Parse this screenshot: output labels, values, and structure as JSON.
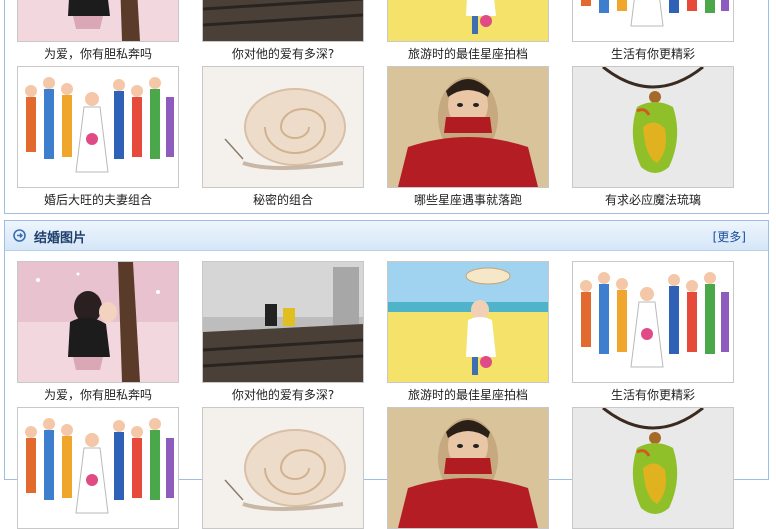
{
  "top_section": {
    "row1": [
      {
        "caption": "为爱，你有胆私奔吗",
        "art": "kiss"
      },
      {
        "caption": "你对他的爱有多深?",
        "art": "rail"
      },
      {
        "caption": "旅游时的最佳星座拍档",
        "art": "beach"
      },
      {
        "caption": "生活有你更精彩",
        "art": "crowd"
      }
    ],
    "row2": [
      {
        "caption": "婚后大旺的夫妻组合",
        "art": "crowd"
      },
      {
        "caption": "秘密的组合",
        "art": "snail"
      },
      {
        "caption": "哪些星座遇事就落跑",
        "art": "man"
      },
      {
        "caption": "有求必应魔法琉璃",
        "art": "glass"
      }
    ]
  },
  "wedding_section": {
    "title": "结婚图片",
    "more_label": "[更多]",
    "icon": "circle-arrow-right-icon",
    "row1": [
      {
        "caption": "为爱，你有胆私奔吗",
        "art": "kiss"
      },
      {
        "caption": "你对他的爱有多深?",
        "art": "rail"
      },
      {
        "caption": "旅游时的最佳星座拍档",
        "art": "beach"
      },
      {
        "caption": "生活有你更精彩",
        "art": "crowd"
      }
    ],
    "row2": [
      {
        "caption": "",
        "art": "crowd"
      },
      {
        "caption": "",
        "art": "snail"
      },
      {
        "caption": "",
        "art": "man"
      },
      {
        "caption": "",
        "art": "glass"
      }
    ]
  },
  "colors": {
    "accent": "#1f3e6b",
    "link": "#1a4d9c",
    "border": "#9fbfe0"
  }
}
